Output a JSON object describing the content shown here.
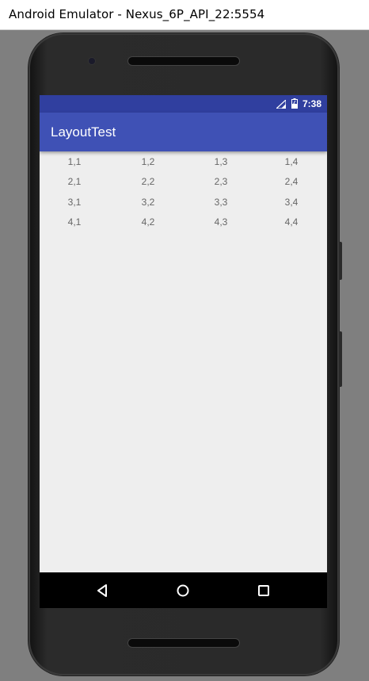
{
  "window": {
    "title": "Android Emulator - Nexus_6P_API_22:5554"
  },
  "status_bar": {
    "time": "7:38",
    "signal_icon": "signal-icon",
    "battery_icon": "battery-icon",
    "color": "#303f9f"
  },
  "app_bar": {
    "title": "LayoutTest",
    "color": "#3f51b5"
  },
  "table": {
    "rows": [
      [
        "1,1",
        "1,2",
        "1,3",
        "1,4"
      ],
      [
        "2,1",
        "2,2",
        "2,3",
        "2,4"
      ],
      [
        "3,1",
        "3,2",
        "3,3",
        "3,4"
      ],
      [
        "4,1",
        "4,2",
        "4,3",
        "4,4"
      ]
    ]
  },
  "nav_bar": {
    "back_icon": "back-icon",
    "home_icon": "home-icon",
    "recents_icon": "recents-icon"
  }
}
